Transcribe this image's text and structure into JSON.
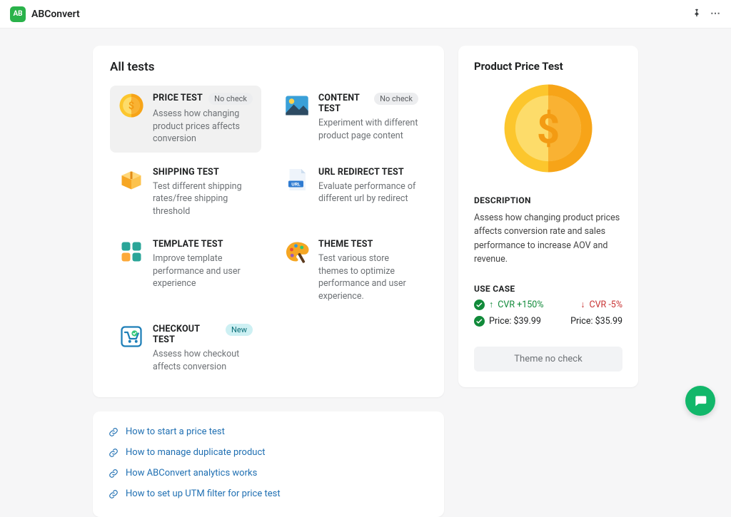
{
  "app": {
    "name": "ABConvert",
    "logo_text": "AB"
  },
  "tests_section_title": "All tests",
  "tests": [
    {
      "name": "PRICE TEST",
      "badge": "No check",
      "badge_kind": "plain",
      "desc": "Assess how changing product prices affects conversion",
      "icon": "coin",
      "selected": true
    },
    {
      "name": "CONTENT TEST",
      "badge": "No check",
      "badge_kind": "plain",
      "desc": "Experiment with different product page content",
      "icon": "picture",
      "selected": false
    },
    {
      "name": "SHIPPING TEST",
      "badge": "",
      "badge_kind": "",
      "desc": "Test different shipping rates/free shipping threshold",
      "icon": "box",
      "selected": false
    },
    {
      "name": "URL REDIRECT TEST",
      "badge": "",
      "badge_kind": "",
      "desc": "Evaluate performance of different url by redirect",
      "icon": "url",
      "selected": false
    },
    {
      "name": "TEMPLATE TEST",
      "badge": "",
      "badge_kind": "",
      "desc": "Improve template performance and user experience",
      "icon": "tiles",
      "selected": false
    },
    {
      "name": "THEME TEST",
      "badge": "",
      "badge_kind": "",
      "desc": "Test various store themes to optimize performance and user experience.",
      "icon": "palette",
      "selected": false
    },
    {
      "name": "CHECKOUT TEST",
      "badge": "New",
      "badge_kind": "new",
      "desc": "Assess how checkout affects conversion",
      "icon": "cart",
      "selected": false
    }
  ],
  "help_links": [
    "How to start a price test",
    "How to manage duplicate product",
    "How ABConvert analytics works",
    "How to set up UTM filter for price test"
  ],
  "detail": {
    "title": "Product Price Test",
    "desc_label": "DESCRIPTION",
    "description": "Assess how changing product prices affects conversion rate and sales performance to increase AOV and revenue.",
    "usecase_label": "USE CASE",
    "cvr_up_label": "CVR +150%",
    "cvr_down_label": "CVR -5%",
    "price_a": "Price: $39.99",
    "price_b": "Price: $35.99",
    "theme_button": "Theme no check"
  }
}
